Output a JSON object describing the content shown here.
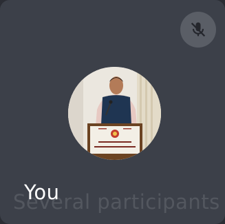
{
  "tile": {
    "participant_name": "You",
    "overlay_caption": "Several participants",
    "mic_status_icon": "mic-off-icon",
    "avatar_icon": "profile-photo-speaker-at-podium"
  },
  "colors": {
    "tile_background": "#3c4049",
    "mute_button_background": "#5a5e66",
    "text_primary": "#ffffff"
  }
}
